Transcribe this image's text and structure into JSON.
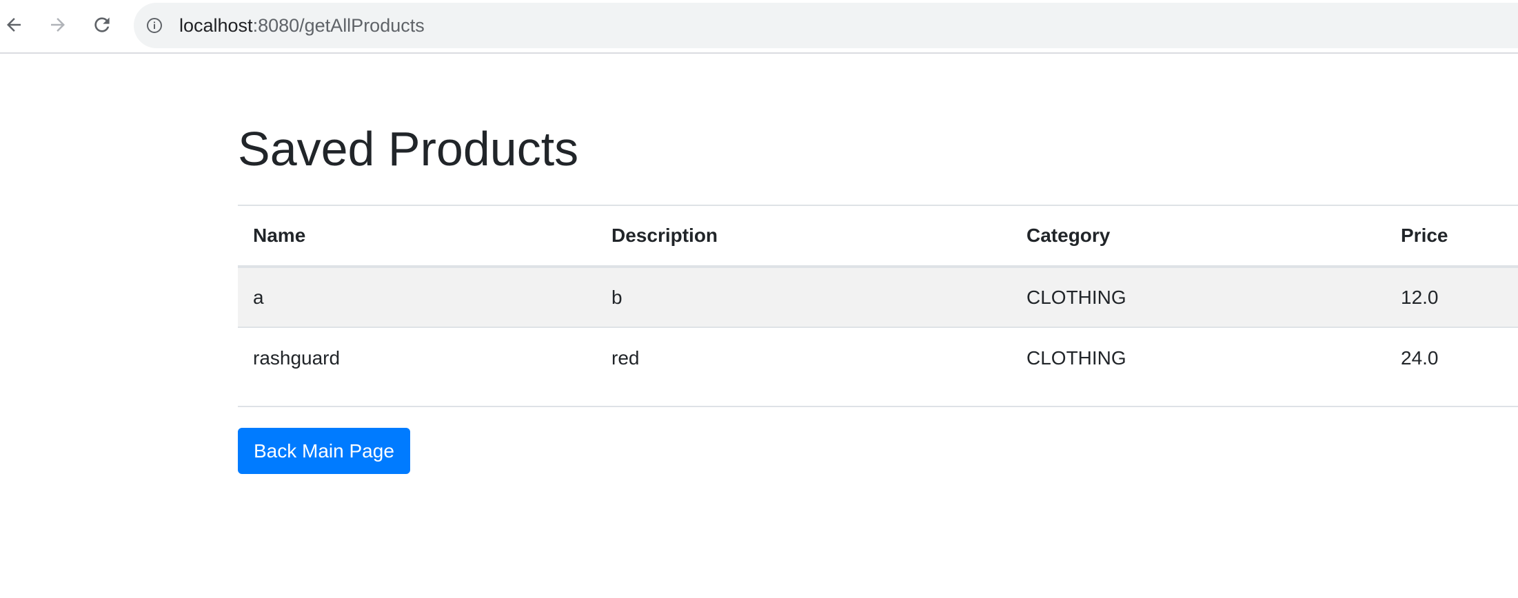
{
  "browser": {
    "url_host": "localhost",
    "url_rest": ":8080/getAllProducts",
    "icons": {
      "back": "arrow-left-icon",
      "forward": "arrow-right-icon",
      "reload": "reload-icon",
      "site_info": "info-icon"
    }
  },
  "page": {
    "title": "Saved Products"
  },
  "table": {
    "headers": {
      "name": "Name",
      "description": "Description",
      "category": "Category",
      "price": "Price"
    },
    "rows": [
      {
        "name": "a",
        "description": "b",
        "category": "CLOTHING",
        "price": "12.0"
      },
      {
        "name": "rashguard",
        "description": "red",
        "category": "CLOTHING",
        "price": "24.0"
      }
    ]
  },
  "actions": {
    "back_label": "Back Main Page"
  },
  "colors": {
    "primary": "#007bff",
    "text": "#212529",
    "stripe": "#f2f2f2",
    "border": "#dee2e6"
  }
}
